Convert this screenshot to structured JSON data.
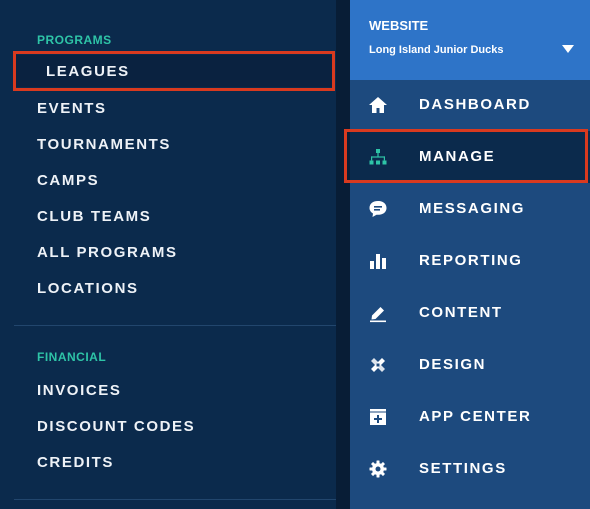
{
  "submenu": {
    "programs_heading": "PROGRAMS",
    "programs": [
      "LEAGUES",
      "EVENTS",
      "TOURNAMENTS",
      "CAMPS",
      "CLUB TEAMS",
      "ALL PROGRAMS",
      "LOCATIONS"
    ],
    "financial_heading": "FINANCIAL",
    "financial": [
      "INVOICES",
      "DISCOUNT CODES",
      "CREDITS"
    ],
    "selected": "LEAGUES"
  },
  "website": {
    "label": "WEBSITE",
    "name": "Long Island Junior Ducks"
  },
  "nav": {
    "items": [
      {
        "label": "DASHBOARD",
        "icon": "home-icon"
      },
      {
        "label": "MANAGE",
        "icon": "org-chart-icon"
      },
      {
        "label": "MESSAGING",
        "icon": "chat-icon"
      },
      {
        "label": "REPORTING",
        "icon": "bar-chart-icon"
      },
      {
        "label": "CONTENT",
        "icon": "pencil-icon"
      },
      {
        "label": "DESIGN",
        "icon": "design-tools-icon"
      },
      {
        "label": "APP CENTER",
        "icon": "app-center-icon"
      },
      {
        "label": "SETTINGS",
        "icon": "gear-icon"
      }
    ],
    "active": "MANAGE"
  },
  "colors": {
    "accent_teal": "#2ec4a7",
    "highlight_red": "#d93a1f",
    "header_blue": "#2e74c8",
    "nav_blue": "#1d4a7e",
    "panel_navy": "#0b2a4c"
  }
}
